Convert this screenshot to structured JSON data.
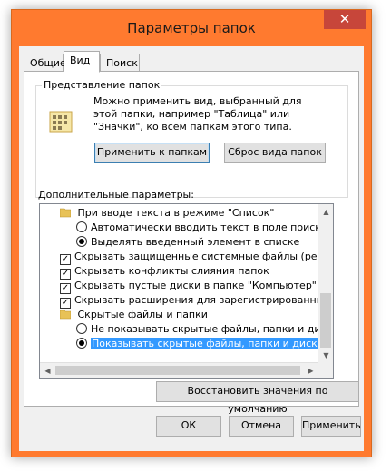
{
  "window": {
    "title": "Параметры папок",
    "close_glyph": "✕"
  },
  "tabs": [
    {
      "label": "Общие",
      "active": false
    },
    {
      "label": "Вид",
      "active": true
    },
    {
      "label": "Поиск",
      "active": false
    }
  ],
  "folder_view": {
    "group_title": "Представление папок",
    "description": "Можно применить вид, выбранный для этой папки, например \"Таблица\" или \"Значки\", ко всем папкам этого типа.",
    "apply_button": "Применить к папкам",
    "reset_button": "Сброс вида папок"
  },
  "advanced": {
    "label": "Дополнительные параметры:",
    "items": [
      {
        "type": "folder",
        "label": "При вводе текста в режиме \"Список\""
      },
      {
        "type": "radio",
        "checked": false,
        "label": "Автоматически вводить текст в поле поиска"
      },
      {
        "type": "radio",
        "checked": true,
        "label": "Выделять введенный элемент в списке"
      },
      {
        "type": "checkbox",
        "checked": true,
        "label": "Скрывать защищенные системные файлы (рекомен"
      },
      {
        "type": "checkbox",
        "checked": true,
        "label": "Скрывать конфликты слияния папок"
      },
      {
        "type": "checkbox",
        "checked": true,
        "label": "Скрывать пустые диски в папке \"Компьютер\""
      },
      {
        "type": "checkbox",
        "checked": true,
        "label": "Скрывать расширения для зарегистрированных типо"
      },
      {
        "type": "folder",
        "label": "Скрытые файлы и папки"
      },
      {
        "type": "radio",
        "checked": false,
        "label": "Не показывать скрытые файлы, папки и диски"
      },
      {
        "type": "radio",
        "checked": true,
        "selected": true,
        "label": "Показывать скрытые файлы, папки и диски"
      }
    ],
    "restore_button": "Восстановить значения по умолчанию"
  },
  "footer": {
    "ok_button": "ОК",
    "cancel_button": "Отмена",
    "apply_button": "Применить"
  },
  "icons": {
    "check": "✓",
    "scroll_up": "▲",
    "scroll_down": "▼",
    "scroll_left": "◀",
    "scroll_right": "▶"
  },
  "colors": {
    "window_frame": "#ff7a2f",
    "close_button": "#c7463a",
    "selection": "#3399ff"
  }
}
